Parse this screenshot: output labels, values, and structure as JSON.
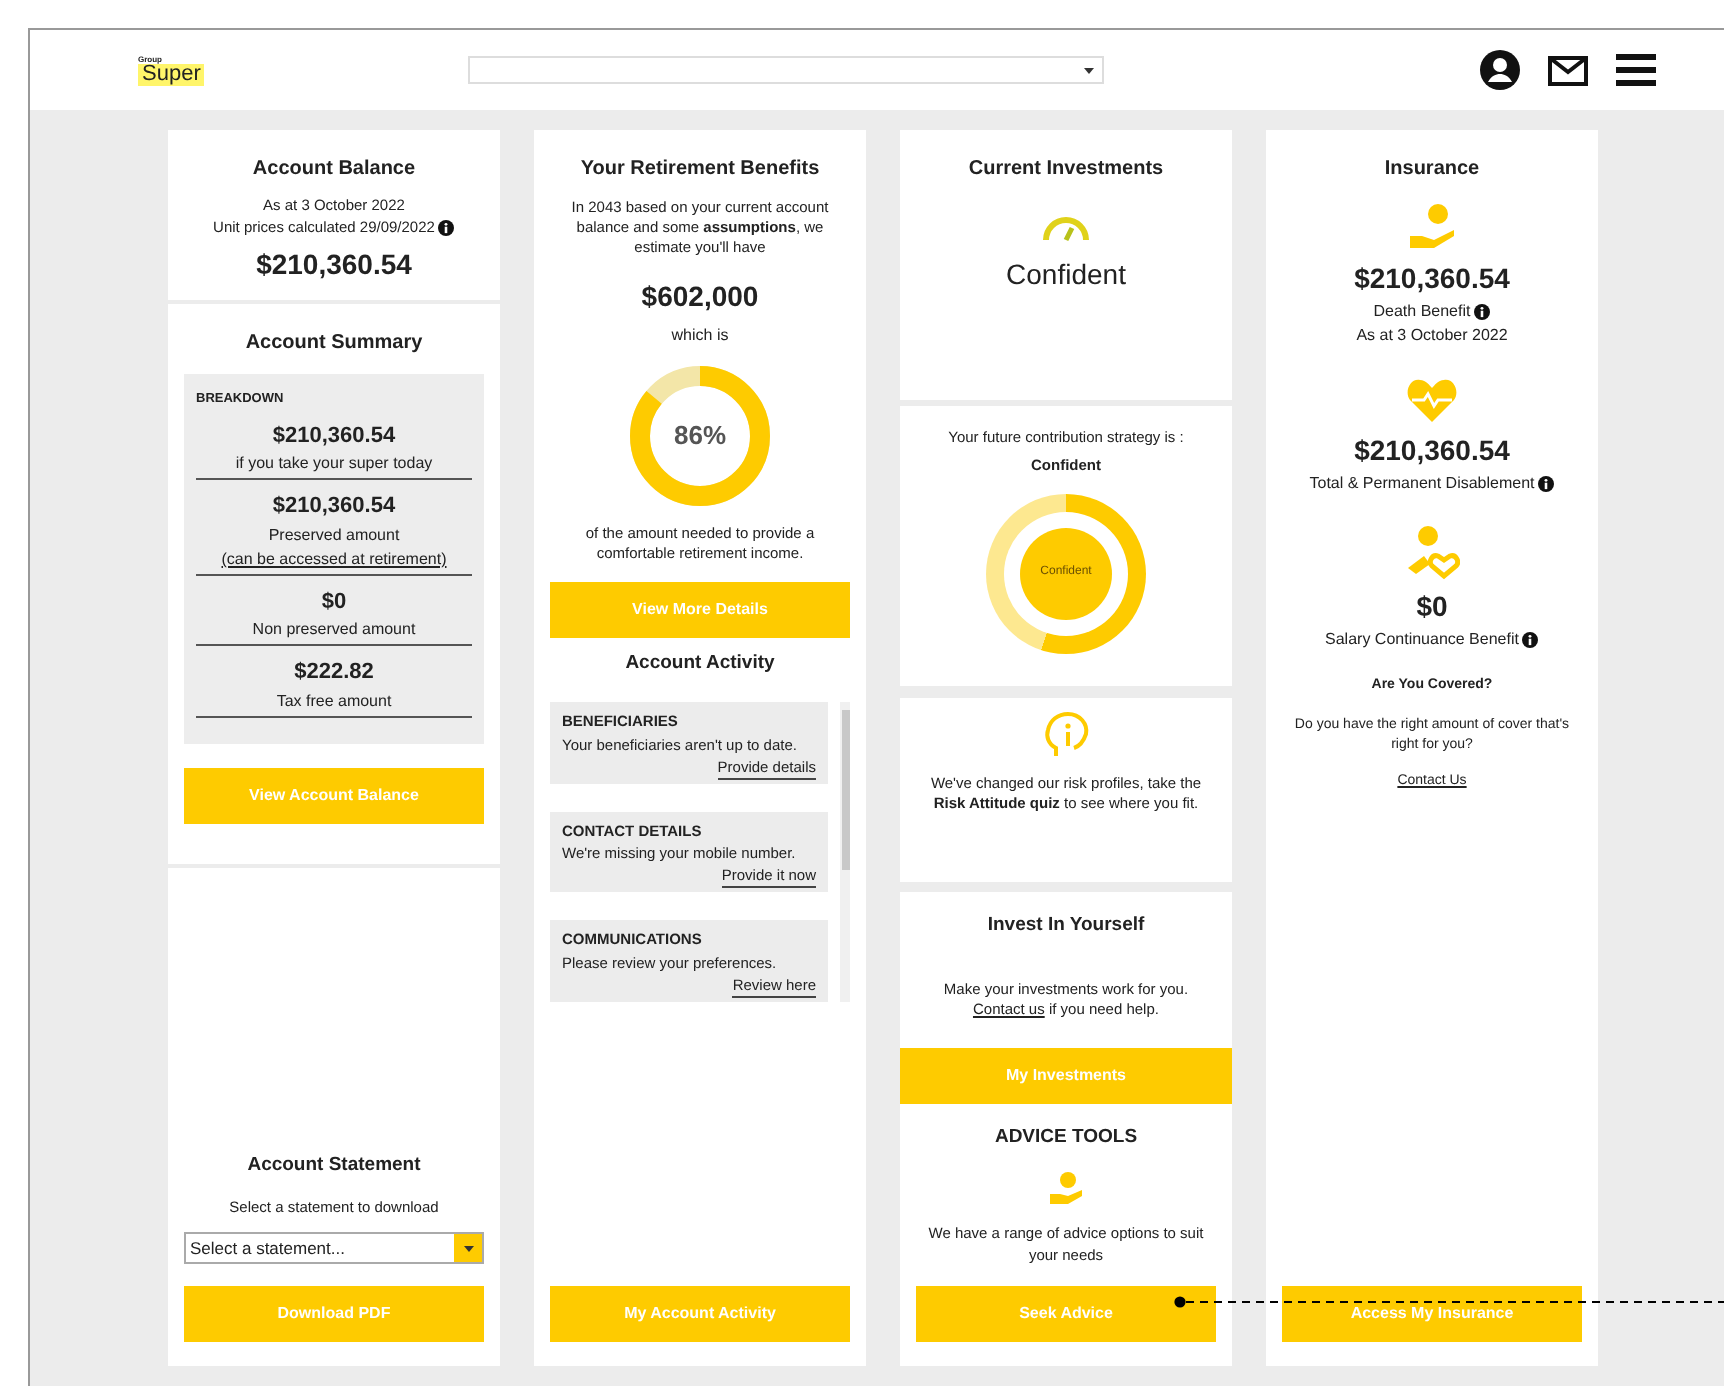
{
  "header": {
    "logo": {
      "small_text": "Group",
      "large_text": "Super"
    }
  },
  "account_balance": {
    "title": "Account Balance",
    "as_at": "As at 3 October 2022",
    "unit_prices": "Unit prices calculated 29/09/2022",
    "amount": "$210,360.54"
  },
  "account_summary": {
    "title": "Account Summary",
    "section": "BREAKDOWN",
    "items": [
      {
        "amount": "$210,360.54",
        "label": "if you take your super today"
      },
      {
        "amount": "$210,360.54",
        "label": "Preserved amount",
        "link": "(can be accessed at retirement)"
      },
      {
        "amount": "$0",
        "label": "Non preserved amount"
      },
      {
        "amount": "$222.82",
        "label": "Tax free amount"
      }
    ],
    "button": "View Account Balance"
  },
  "account_statement": {
    "title": "Account Statement",
    "hint": "Select a statement to download",
    "select_placeholder": "Select a statement...",
    "button": "Download PDF"
  },
  "retirement": {
    "title": "Your Retirement Benefits",
    "intro": "In 2043 based on your current account balance and some **assumptions**, we estimate you'll have",
    "amount": "$602,000",
    "which_is": "which is",
    "percent": "86%",
    "outro": "of the amount needed to provide a comfortable retirement income.",
    "button": "View More Details"
  },
  "account_activity": {
    "title": "Account Activity",
    "items": [
      {
        "heading": "BENEFICIARIES",
        "text": "Your beneficiaries aren't up to date.",
        "link": "Provide details"
      },
      {
        "heading": "CONTACT DETAILS",
        "text": "We're missing your mobile number.",
        "link": "Provide it now"
      },
      {
        "heading": "COMMUNICATIONS",
        "text": "Please review your preferences.",
        "link": "Review here"
      }
    ],
    "button": "My Account Activity"
  },
  "current_investments": {
    "title": "Current Investments",
    "profile": "Confident"
  },
  "strategy": {
    "text": "Your future contribution strategy is :",
    "value": "Confident",
    "donut_label": "Confident"
  },
  "risk": {
    "text": "We've changed our risk profiles, take the **Risk Attitude quiz** to see where you fit."
  },
  "invest_yourself": {
    "title": "Invest In Yourself",
    "text_before": "Make your investments work for you.",
    "link": "Contact us",
    "text_after": "if you need help.",
    "button": "My Investments"
  },
  "advice_tools": {
    "title": "ADVICE TOOLS",
    "text": "We have a range of advice options to suit your needs",
    "button": "Seek Advice"
  },
  "insurance": {
    "title": "Insurance",
    "items": [
      {
        "kind": "hand",
        "amount": "$210,360.54",
        "label": "Death Benefit",
        "sub": "As at 3 October 2022"
      },
      {
        "kind": "heart",
        "amount": "$210,360.54",
        "label": "Total & Permanent Disablement"
      },
      {
        "kind": "salary",
        "amount": "$0",
        "label": "Salary Continuance Benefit"
      }
    ],
    "covered_title": "Are You Covered?",
    "covered_text": "Do you have the right amount of cover that's right for you?",
    "link": "Contact Us",
    "button": "Access My Insurance"
  }
}
